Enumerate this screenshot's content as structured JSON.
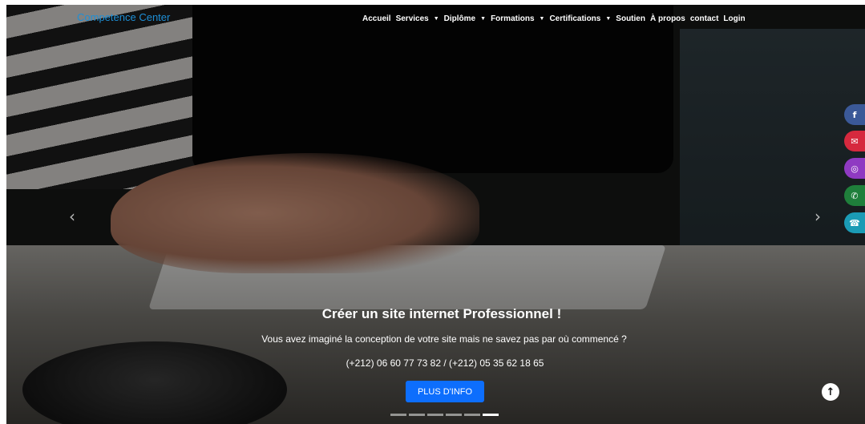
{
  "brand": "Competence Center",
  "nav": [
    {
      "label": "Accueil",
      "has_caret": false
    },
    {
      "label": "Services",
      "has_caret": true
    },
    {
      "label": "Diplôme",
      "has_caret": true
    },
    {
      "label": "Formations",
      "has_caret": true
    },
    {
      "label": "Certifications",
      "has_caret": true
    },
    {
      "label": "Soutien",
      "has_caret": false
    },
    {
      "label": "À propos",
      "has_caret": false
    },
    {
      "label": "contact",
      "has_caret": false
    },
    {
      "label": "Login",
      "has_caret": false
    }
  ],
  "carousel": {
    "prev_icon": "chevron-left-icon",
    "next_icon": "chevron-right-icon",
    "title": "Créer un site internet Professionnel !",
    "subtitle": "Vous avez imaginé la conception de votre site mais ne savez pas par où commencé ?",
    "phone": "(+212) 06 60 77 73 82 / (+212) 05 35 62 18 65",
    "cta": "PLUS D'INFO",
    "slide_count": 6,
    "active_index": 5
  },
  "socials": [
    {
      "name": "facebook-icon",
      "glyph": "f",
      "color": "#3b5998"
    },
    {
      "name": "email-icon",
      "glyph": "✉",
      "color": "#d6293e"
    },
    {
      "name": "instagram-icon",
      "glyph": "◎",
      "color": "#8f3ac2"
    },
    {
      "name": "whatsapp-icon",
      "glyph": "✆",
      "color": "#1f7f3b"
    },
    {
      "name": "phone-icon",
      "glyph": "☎",
      "color": "#1b9bb5"
    }
  ],
  "back_to_top_icon": "arrow-up-icon",
  "colors": {
    "brand": "#1e8fd6",
    "cta": "#0d6efd"
  }
}
